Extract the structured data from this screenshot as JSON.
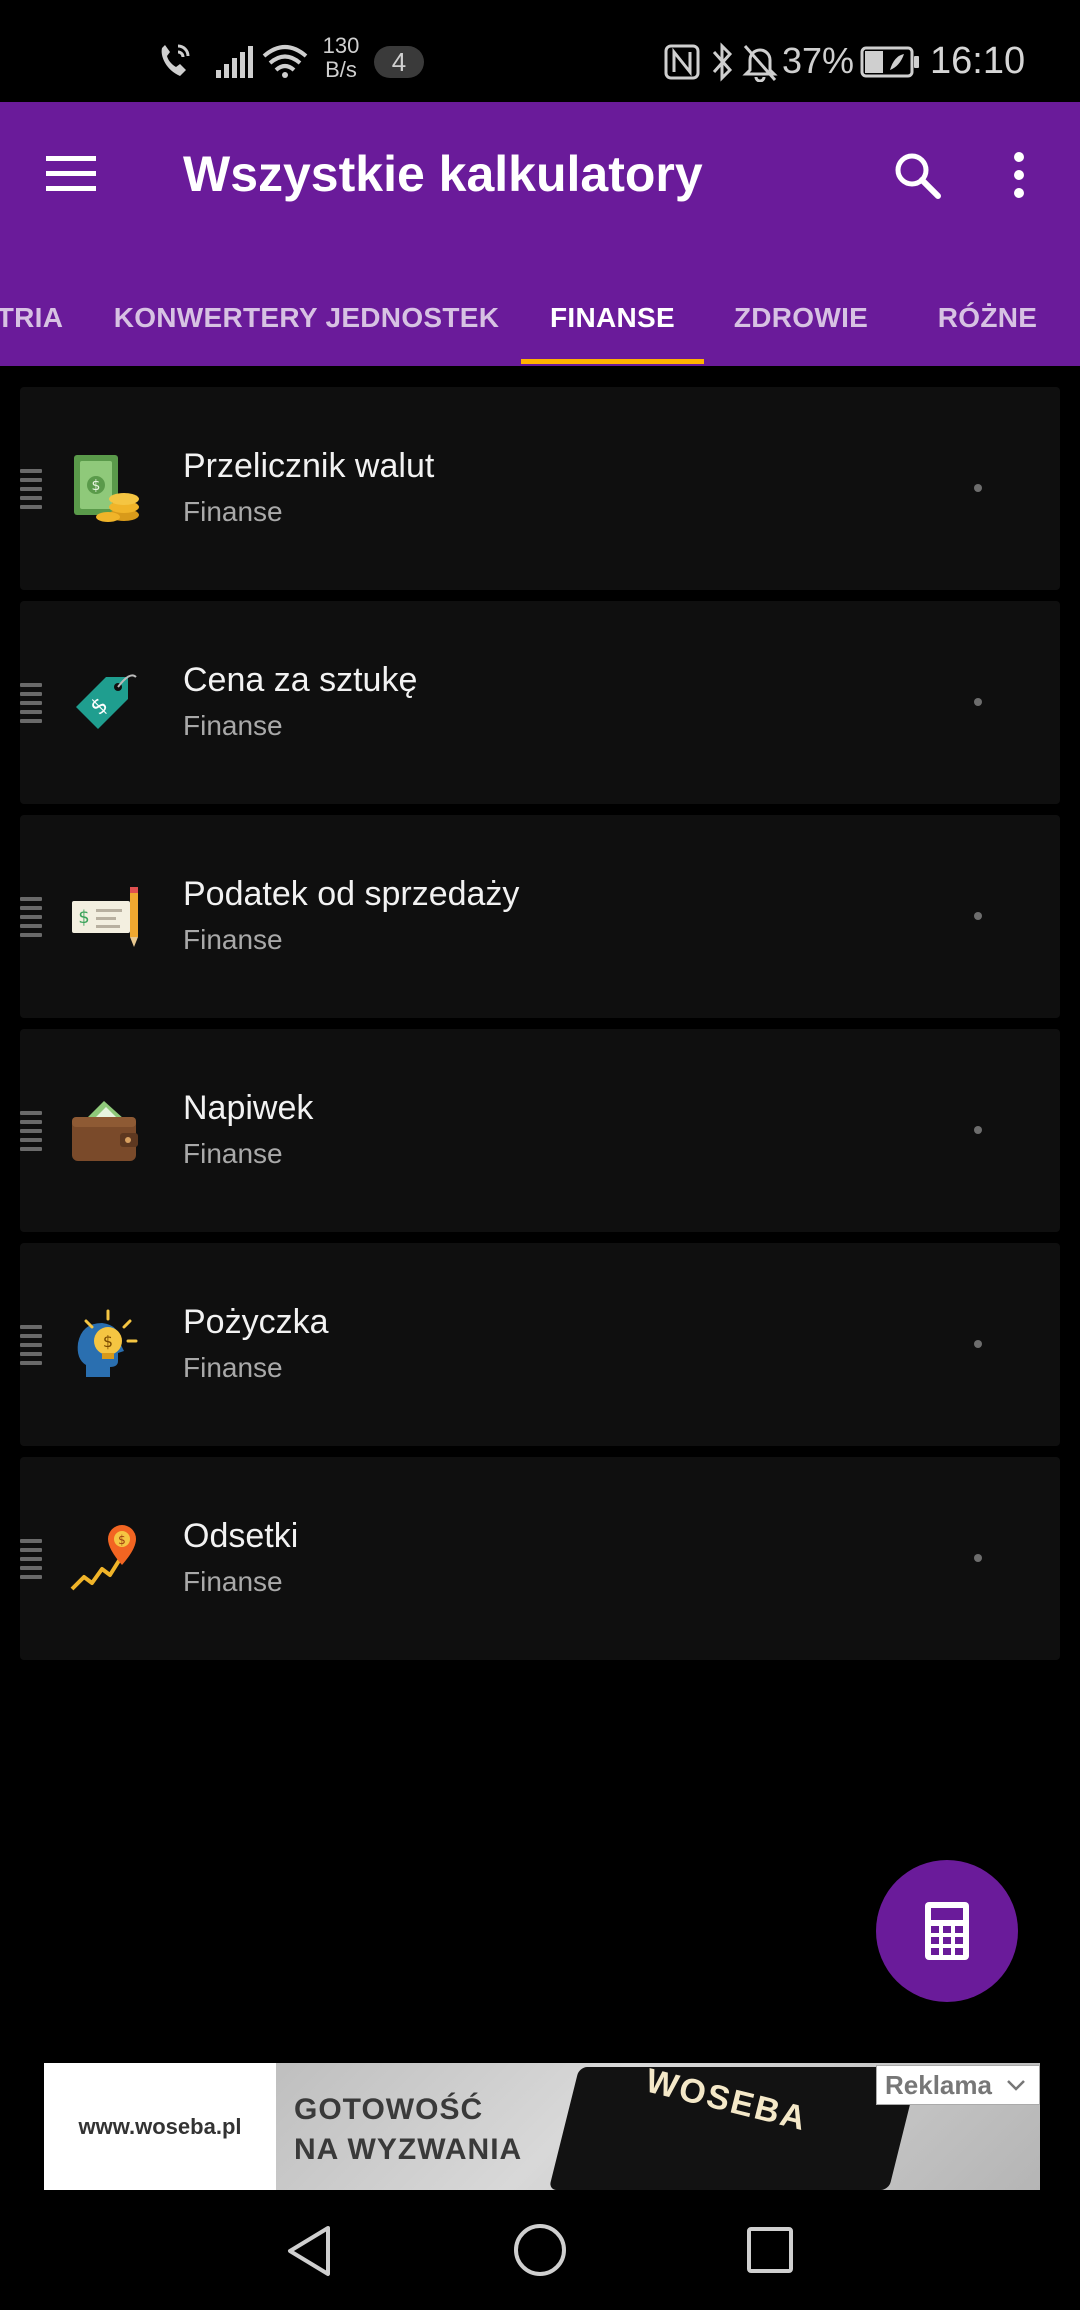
{
  "status_bar": {
    "net_speed_value": "130",
    "net_speed_unit": "B/s",
    "notification_count": "4",
    "battery_percent": "37%",
    "time": "16:10"
  },
  "app_bar": {
    "title": "Wszystkie kalkulatory"
  },
  "tabs": [
    {
      "label": "TRIA",
      "active": false
    },
    {
      "label": "KONWERTERY JEDNOSTEK",
      "active": false
    },
    {
      "label": "FINANSE",
      "active": true
    },
    {
      "label": "ZDROWIE",
      "active": false
    },
    {
      "label": "RÓŻNE",
      "active": false
    }
  ],
  "calculators": [
    {
      "title": "Przelicznik walut",
      "category": "Finanse",
      "icon": "money-coins-icon"
    },
    {
      "title": "Cena za sztukę",
      "category": "Finanse",
      "icon": "price-tag-icon"
    },
    {
      "title": "Podatek od sprzedaży",
      "category": "Finanse",
      "icon": "check-pencil-icon"
    },
    {
      "title": "Napiwek",
      "category": "Finanse",
      "icon": "wallet-icon"
    },
    {
      "title": "Pożyczka",
      "category": "Finanse",
      "icon": "idea-head-icon"
    },
    {
      "title": "Odsetki",
      "category": "Finanse",
      "icon": "growth-pin-icon"
    }
  ],
  "ad": {
    "website": "www.woseba.pl",
    "line1": "GOTOWOŚĆ",
    "line2": "NA WYZWANIA",
    "brand": "WOSEBA",
    "label": "Reklama"
  },
  "colors": {
    "primary": "#6a1b9a",
    "tab_indicator": "#ffb300",
    "card_background": "#0f0f0f",
    "background": "#000000"
  }
}
